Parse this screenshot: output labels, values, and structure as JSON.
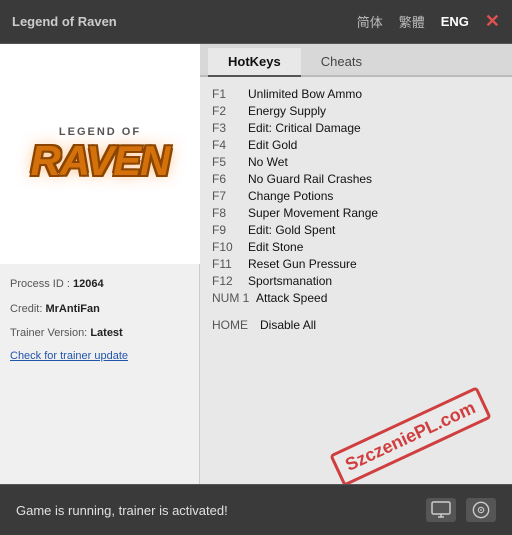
{
  "titleBar": {
    "title": "Legend of Raven",
    "lang_simplified": "简体",
    "lang_traditional": "繁體",
    "lang_english": "ENG",
    "close": "✕"
  },
  "logo": {
    "legend": "LEGEND OF",
    "raven": "RAVEN"
  },
  "info": {
    "process_label": "Process ID : ",
    "process_value": "12064",
    "credit_label": "Credit:",
    "credit_value": "MrAntiFan",
    "trainer_label": "Trainer Version:",
    "trainer_value": "Latest",
    "update_link": "Check for trainer update"
  },
  "tabs": [
    {
      "label": "HotKeys",
      "active": true
    },
    {
      "label": "Cheats",
      "active": false
    }
  ],
  "hotkeys": [
    {
      "key": "F1",
      "desc": "Unlimited Bow Ammo"
    },
    {
      "key": "F2",
      "desc": "Energy Supply"
    },
    {
      "key": "F3",
      "desc": "Edit: Critical Damage"
    },
    {
      "key": "F4",
      "desc": "Edit Gold"
    },
    {
      "key": "F5",
      "desc": "No Wet"
    },
    {
      "key": "F6",
      "desc": "No Guard Rail Crashes"
    },
    {
      "key": "F7",
      "desc": "Change Potions"
    },
    {
      "key": "F8",
      "desc": "Super Movement Range"
    },
    {
      "key": "F9",
      "desc": "Edit: Gold Spent"
    },
    {
      "key": "F10",
      "desc": "Edit Stone"
    },
    {
      "key": "F11",
      "desc": "Reset Gun Pressure"
    },
    {
      "key": "F12",
      "desc": "Sportsmanation"
    },
    {
      "key": "NUM 1",
      "desc": "Attack Speed"
    }
  ],
  "home_hotkey": {
    "key": "HOME",
    "desc": "Disable All"
  },
  "stamp": {
    "text": "SzczeniePL.com"
  },
  "statusBar": {
    "message": "Game is running, trainer is activated!",
    "icon1": "monitor",
    "icon2": "music"
  }
}
